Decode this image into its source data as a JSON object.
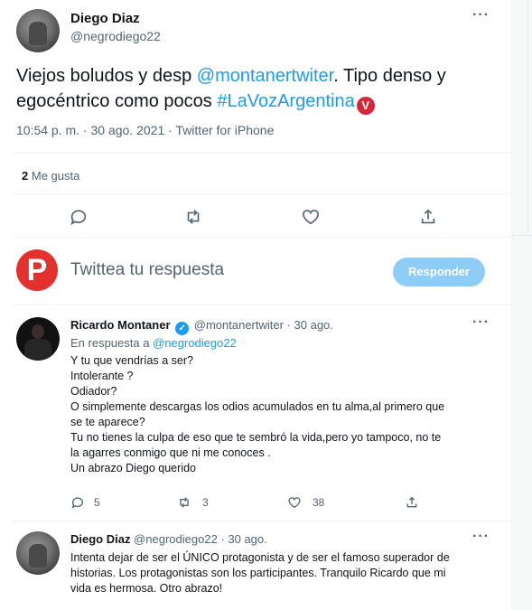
{
  "main_tweet": {
    "author_name": "Diego Diaz",
    "author_handle": "@negrodiego22",
    "text_before": "Viejos boludos y desp ",
    "mention": "@montanertwiter",
    "text_middle": ". Tipo denso y egocéntrico como pocos ",
    "hashtag": "#LaVozArgentina",
    "hashtag_badge": "V",
    "timestamp": "10:54 p. m. · 30 ago. 2021 · Twitter for iPhone",
    "like_count": "2",
    "like_label": "Me gusta",
    "more_label": "···"
  },
  "composer": {
    "avatar_letter": "P",
    "placeholder": "Twittea tu respuesta",
    "button_label": "Responder"
  },
  "reply_ricardo": {
    "author_name": "Ricardo Montaner",
    "verified_mark": "✓",
    "author_handle": "@montanertwiter",
    "date": "· 30 ago.",
    "in_reply_prefix": "En respuesta a ",
    "in_reply_handle": "@negrodiego22",
    "lines": [
      "Y tu que vendrías a ser?",
      "Intolerante ?",
      "Odiador?",
      "O simplemente descargas los odios acumulados en tu alma,al primero que",
      "se te aparece?",
      "Tu no tienes la culpa de eso que te sembró la vida,pero yo tampoco, no te",
      "la agarres conmigo que ni me conoces .",
      "Un abrazo Diego querido"
    ],
    "replies": "5",
    "retweets": "3",
    "likes": "38",
    "more_label": "···"
  },
  "reply_diego": {
    "author_name": "Diego Diaz",
    "author_handle": "@negrodiego22",
    "date": "· 30 ago.",
    "lines": [
      "Intenta dejar de ser el ÚNICO protagonista y de ser el famoso superador de",
      "historias. Los protagonistas son los participantes. Tranquilo Ricardo que mi",
      "vida es hermosa. Otro abrazo!"
    ],
    "more_label": "···"
  },
  "colors": {
    "link": "#1d9bf0",
    "secondary_text": "#536471",
    "reply_button": "#8ecdf8",
    "brand_p": "#e3312d",
    "hashtag_badge": "#d6263a"
  },
  "icons": [
    "comment-icon",
    "retweet-icon",
    "heart-icon",
    "share-icon",
    "more-icon",
    "verified-icon"
  ]
}
